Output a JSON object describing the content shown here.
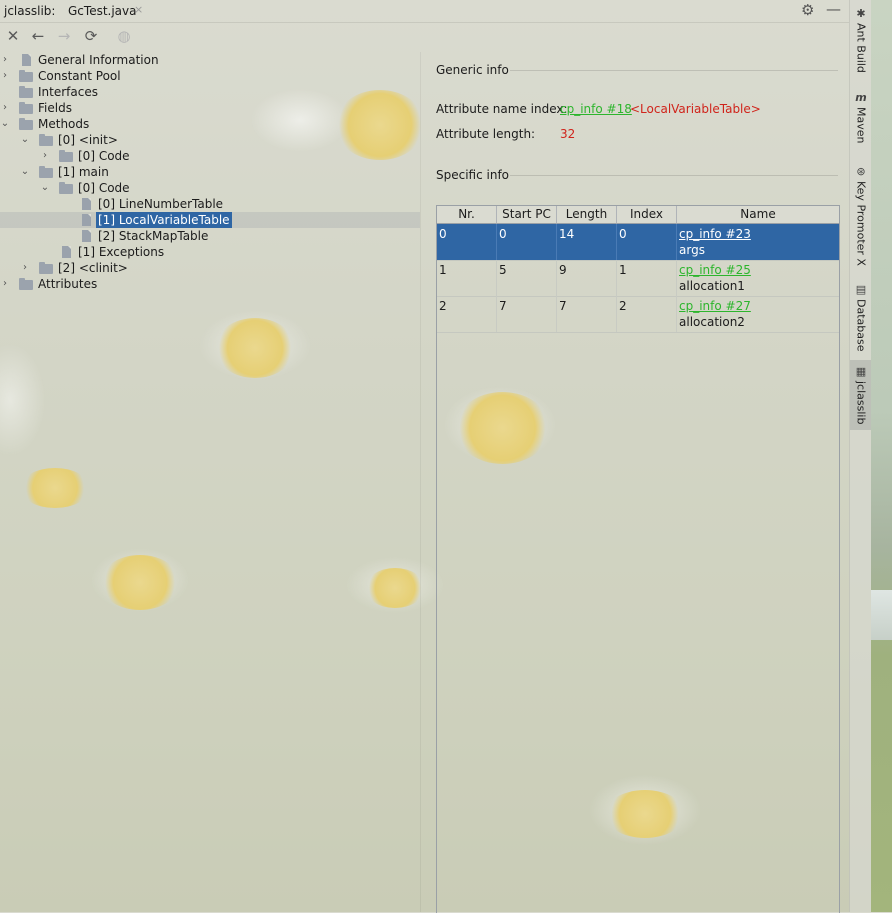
{
  "title_bar": {
    "tool_name": "jclasslib:",
    "tab_label": "GcTest.java",
    "tab_close": "×",
    "settings_icon": "gear-icon",
    "minimize_icon": "minimize-icon"
  },
  "toolbar": {
    "close_icon": "close-icon",
    "back_icon": "back-arrow-icon",
    "forward_icon": "forward-arrow-icon",
    "refresh_icon": "refresh-icon",
    "browser_icon": "browser-icon"
  },
  "tree": {
    "general_information": "General Information",
    "constant_pool": "Constant Pool",
    "interfaces": "Interfaces",
    "fields": "Fields",
    "methods": "Methods",
    "init": "[0] <init>",
    "init_code": "[0] Code",
    "main": "[1] main",
    "main_code": "[0] Code",
    "line_number_table": "[0] LineNumberTable",
    "local_variable_table": "[1] LocalVariableTable",
    "stack_map_table": "[2] StackMapTable",
    "exceptions": "[1] Exceptions",
    "clinit": "[2] <clinit>",
    "attributes": "Attributes"
  },
  "detail": {
    "generic_info_title": "Generic info",
    "attr_name_label": "Attribute name index:",
    "attr_name_link": "cp_info #18",
    "attr_name_value": "<LocalVariableTable>",
    "attr_length_label": "Attribute length:",
    "attr_length_value": "32",
    "specific_info_title": "Specific info"
  },
  "table": {
    "columns": [
      "Nr.",
      "Start PC",
      "Length",
      "Index",
      "Name"
    ],
    "rows": [
      {
        "nr": "0",
        "start_pc": "0",
        "length": "14",
        "index": "0",
        "name_link": "cp_info #23",
        "name": "args"
      },
      {
        "nr": "1",
        "start_pc": "5",
        "length": "9",
        "index": "1",
        "name_link": "cp_info #25",
        "name": "allocation1"
      },
      {
        "nr": "2",
        "start_pc": "7",
        "length": "7",
        "index": "2",
        "name_link": "cp_info #27",
        "name": "allocation2"
      }
    ]
  },
  "sidebar": {
    "ant_build": "Ant Build",
    "maven": "Maven",
    "key_promoter": "Key Promoter X",
    "database": "Database",
    "jclasslib": "jclasslib"
  },
  "colors": {
    "selection": "#2f66a4",
    "link_green": "#2db52d",
    "value_red": "#d0241b"
  }
}
